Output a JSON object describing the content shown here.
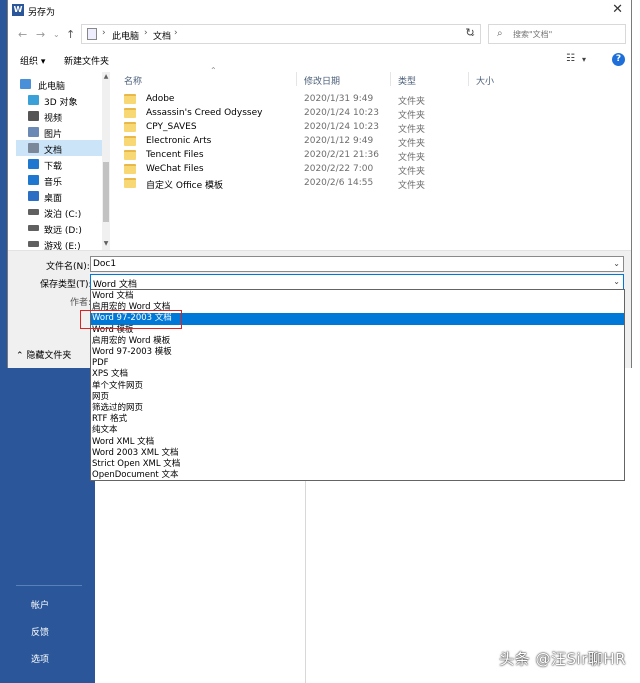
{
  "dialog": {
    "title": "另存为",
    "app_icon": "W"
  },
  "address": {
    "crumbs": [
      "此电脑",
      "文档"
    ],
    "search_placeholder": "搜索\"文档\""
  },
  "toolbar": {
    "organize": "组织 ▾",
    "new_folder": "新建文件夹"
  },
  "nav": {
    "items": [
      {
        "label": "此电脑",
        "icon": "computer-icon",
        "color": "#4a90d9"
      },
      {
        "label": "3D 对象",
        "icon": "cube-icon",
        "color": "#3aa0d8"
      },
      {
        "label": "视频",
        "icon": "video-icon",
        "color": "#555555"
      },
      {
        "label": "图片",
        "icon": "picture-icon",
        "color": "#6a8ab5"
      },
      {
        "label": "文档",
        "icon": "document-icon",
        "color": "#7a8899"
      },
      {
        "label": "下载",
        "icon": "download-icon",
        "color": "#1e78d0"
      },
      {
        "label": "音乐",
        "icon": "music-icon",
        "color": "#1e78d0"
      },
      {
        "label": "桌面",
        "icon": "desktop-icon",
        "color": "#2a6fc4"
      },
      {
        "label": "泼泊 (C:)",
        "icon": "drive-icon",
        "color": "#606060"
      },
      {
        "label": "致远 (D:)",
        "icon": "drive-icon",
        "color": "#606060"
      },
      {
        "label": "游戏 (E:)",
        "icon": "drive-icon",
        "color": "#606060"
      }
    ],
    "selected_index": 4
  },
  "columns": {
    "name": "名称",
    "date": "修改日期",
    "type": "类型",
    "size": "大小"
  },
  "files": [
    {
      "name": "Adobe",
      "date": "2020/1/31 9:49",
      "type": "文件夹"
    },
    {
      "name": "Assassin's Creed Odyssey",
      "date": "2020/1/24 10:23",
      "type": "文件夹"
    },
    {
      "name": "CPY_SAVES",
      "date": "2020/1/24 10:23",
      "type": "文件夹"
    },
    {
      "name": "Electronic Arts",
      "date": "2020/1/12 9:49",
      "type": "文件夹"
    },
    {
      "name": "Tencent Files",
      "date": "2020/2/21 21:36",
      "type": "文件夹"
    },
    {
      "name": "WeChat Files",
      "date": "2020/2/22 7:00",
      "type": "文件夹"
    },
    {
      "name": "自定义 Office 模板",
      "date": "2020/2/6 14:55",
      "type": "文件夹"
    }
  ],
  "form": {
    "filename_label": "文件名(N):",
    "filename_value": "Doc1",
    "savetype_label": "保存类型(T):",
    "savetype_value": "Word 文档",
    "author_label": "作者:",
    "hide_folders": "隐藏文件夹"
  },
  "save_types": [
    "Word 文档",
    "启用宏的 Word 文档",
    "Word 97-2003 文档",
    "Word 模板",
    "启用宏的 Word 模板",
    "Word 97-2003 模板",
    "PDF",
    "XPS 文档",
    "单个文件网页",
    "网页",
    "筛选过的网页",
    "RTF 格式",
    "纯文本",
    "Word XML 文档",
    "Word 2003 XML 文档",
    "Strict Open XML 文档",
    "OpenDocument 文本"
  ],
  "save_types_highlight_index": 2,
  "backstage": {
    "items": [
      "帐户",
      "反馈",
      "选项"
    ]
  },
  "watermark": "头条 @汪Sir聊HR",
  "colors": {
    "word_blue": "#2b579a",
    "highlight": "#0078d7",
    "annotation_red": "#dd2222"
  }
}
